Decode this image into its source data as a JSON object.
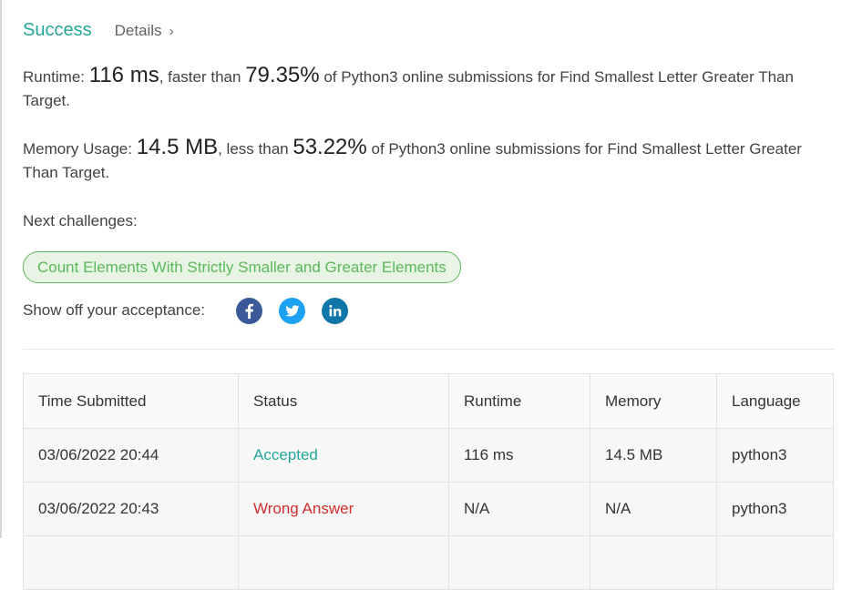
{
  "result": {
    "status": "Success",
    "details_label": "Details",
    "details_chevron": "›"
  },
  "runtime": {
    "label": "Runtime:",
    "value": "116 ms",
    "sep": ", faster than",
    "percent": "79.35%",
    "suffix": "of Python3 online submissions for Find Smallest Letter Greater Than Target."
  },
  "memory": {
    "label": "Memory Usage:",
    "value": "14.5 MB",
    "sep": ", less than",
    "percent": "53.22%",
    "suffix": "of Python3 online submissions for Find Smallest Letter Greater Than Target."
  },
  "next_challenges": {
    "label": "Next challenges:",
    "items": [
      "Count Elements With Strictly Smaller and Greater Elements"
    ]
  },
  "share": {
    "label": "Show off your acceptance:",
    "icons": [
      "facebook-icon",
      "twitter-icon",
      "linkedin-icon"
    ]
  },
  "submissions": {
    "headers": [
      "Time Submitted",
      "Status",
      "Runtime",
      "Memory",
      "Language"
    ],
    "rows": [
      {
        "time": "03/06/2022 20:44",
        "status": "Accepted",
        "runtime": "116 ms",
        "memory": "14.5 MB",
        "language": "python3"
      },
      {
        "time": "03/06/2022 20:43",
        "status": "Wrong Answer",
        "runtime": "N/A",
        "memory": "N/A",
        "language": "python3"
      }
    ]
  },
  "colors": {
    "accepted": "#26a69a",
    "wrong": "#d32f2f",
    "pill_border": "#5cb85c",
    "pill_bg": "#e8f5e4",
    "facebook": "#3b5998",
    "twitter": "#1da1f2",
    "linkedin": "#0e76a8"
  }
}
